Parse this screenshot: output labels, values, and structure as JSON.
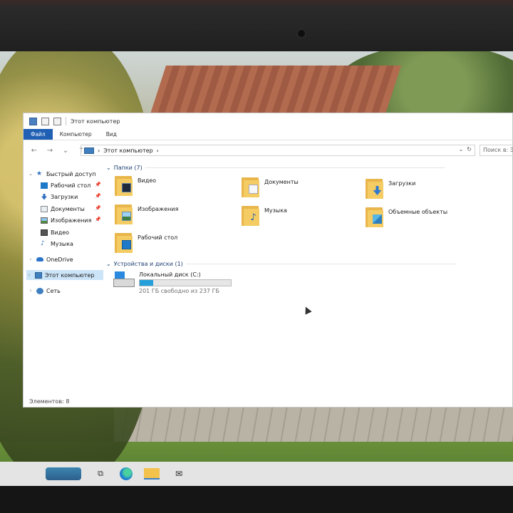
{
  "window": {
    "title": "Этот компьютер",
    "tabs": [
      "Файл",
      "Компьютер",
      "Вид"
    ],
    "address": "Этот компьютер",
    "search_placeholder": "Поиск в: Этот компьютер"
  },
  "nav": {
    "quick_access": "Быстрый доступ",
    "items": [
      {
        "label": "Рабочий стол",
        "icon": "desktop-icon",
        "pinned": true
      },
      {
        "label": "Загрузки",
        "icon": "download-icon",
        "pinned": true
      },
      {
        "label": "Документы",
        "icon": "documents-icon",
        "pinned": true
      },
      {
        "label": "Изображения",
        "icon": "pictures-icon",
        "pinned": true
      },
      {
        "label": "Видео",
        "icon": "video-icon",
        "pinned": false
      },
      {
        "label": "Музыка",
        "icon": "music-icon",
        "pinned": false
      }
    ],
    "onedrive": "OneDrive",
    "this_pc": "Этот компьютер",
    "network": "Сеть"
  },
  "content": {
    "folders_header": "Папки (7)",
    "folders": [
      {
        "name": "Видео",
        "icon": "video-folder-icon"
      },
      {
        "name": "Документы",
        "icon": "documents-folder-icon"
      },
      {
        "name": "Загрузки",
        "icon": "downloads-folder-icon"
      },
      {
        "name": "Изображения",
        "icon": "pictures-folder-icon"
      },
      {
        "name": "Музыка",
        "icon": "music-folder-icon"
      },
      {
        "name": "Объемные объекты",
        "icon": "3d-objects-folder-icon"
      },
      {
        "name": "Рабочий стол",
        "icon": "desktop-folder-icon"
      }
    ],
    "devices_header": "Устройства и диски (1)",
    "drive": {
      "name": "Локальный диск (C:)",
      "free_text": "201 ГБ свободно из 237 ГБ",
      "used_fraction": 0.152
    }
  },
  "status": {
    "items_count": "Элементов: 8"
  },
  "taskbar": {
    "icons": [
      "weather-icon",
      "task-view-icon",
      "edge-icon",
      "file-explorer-icon",
      "mail-icon"
    ]
  }
}
